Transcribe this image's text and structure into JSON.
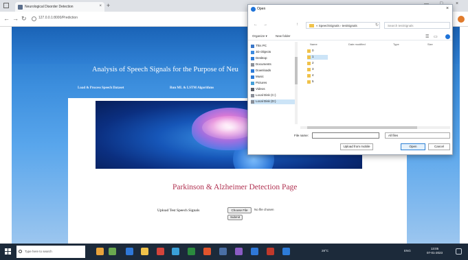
{
  "browser": {
    "tab_title": "Neurological Disorder Detection",
    "tab_close": "×",
    "new_tab": "+",
    "url": "127.0.0.1:8000/Prediction",
    "controls": {
      "minimize": "—",
      "maximize": "□",
      "close": "×"
    },
    "nav": {
      "back": "←",
      "forward": "→",
      "refresh": "↻"
    }
  },
  "site": {
    "title": "Analysis of Speech Signals for the Purpose of Neu",
    "nav": [
      {
        "label": "Load & Process Speech Dataset"
      },
      {
        "label": "Run ML & LSTM Algorithms"
      }
    ]
  },
  "main": {
    "heading": "Parkinson & Alzheimer Detection Page",
    "upload_label": "Upload Test Speech Signals",
    "choose_button": "Choose File",
    "no_file_text": "No file chosen",
    "submit_button": "Submit"
  },
  "dialog": {
    "title": "Open",
    "close": "×",
    "address": "« SpeechSignals › testSignals",
    "search_placeholder": "Search testSignals",
    "nav": {
      "back": "←",
      "forward": "→",
      "up": "↑",
      "refresh": "↻"
    },
    "toolbar": {
      "organize": "Organize ▾",
      "new_folder": "New folder"
    },
    "tree": [
      {
        "label": "This PC",
        "icon": "pc-icon",
        "color": "#3b78c9"
      },
      {
        "label": "3D Objects",
        "icon": "cube-icon",
        "color": "#3d8be0"
      },
      {
        "label": "Desktop",
        "icon": "desktop-icon",
        "color": "#2d7bd8"
      },
      {
        "label": "Documents",
        "icon": "document-icon",
        "color": "#8a8f99"
      },
      {
        "label": "Downloads",
        "icon": "download-icon",
        "color": "#2d7bd8"
      },
      {
        "label": "Music",
        "icon": "music-icon",
        "color": "#2d7bd8"
      },
      {
        "label": "Pictures",
        "icon": "picture-icon",
        "color": "#46a0d8"
      },
      {
        "label": "Videos",
        "icon": "video-icon",
        "color": "#5a5f6a"
      },
      {
        "label": "Local Disk (C:)",
        "icon": "disk-icon",
        "color": "#8a8f99"
      },
      {
        "label": "Local Disk (D:)",
        "icon": "disk-icon",
        "color": "#8a8f99"
      }
    ],
    "columns": [
      "Name",
      "Date modified",
      "Type",
      "Size"
    ],
    "files": [
      "0",
      "1",
      "2",
      "3",
      "4",
      "5"
    ],
    "filename_label": "File name:",
    "filter": "All files",
    "buttons": {
      "upload_from_mobile": "Upload from mobile",
      "open": "Open",
      "cancel": "Cancel"
    }
  },
  "taskbar": {
    "search_placeholder": "Type here to search",
    "tray": {
      "weather": "28°C",
      "language": "ENG"
    },
    "clock": {
      "time": "13:05",
      "date": "07-01-2023"
    }
  }
}
